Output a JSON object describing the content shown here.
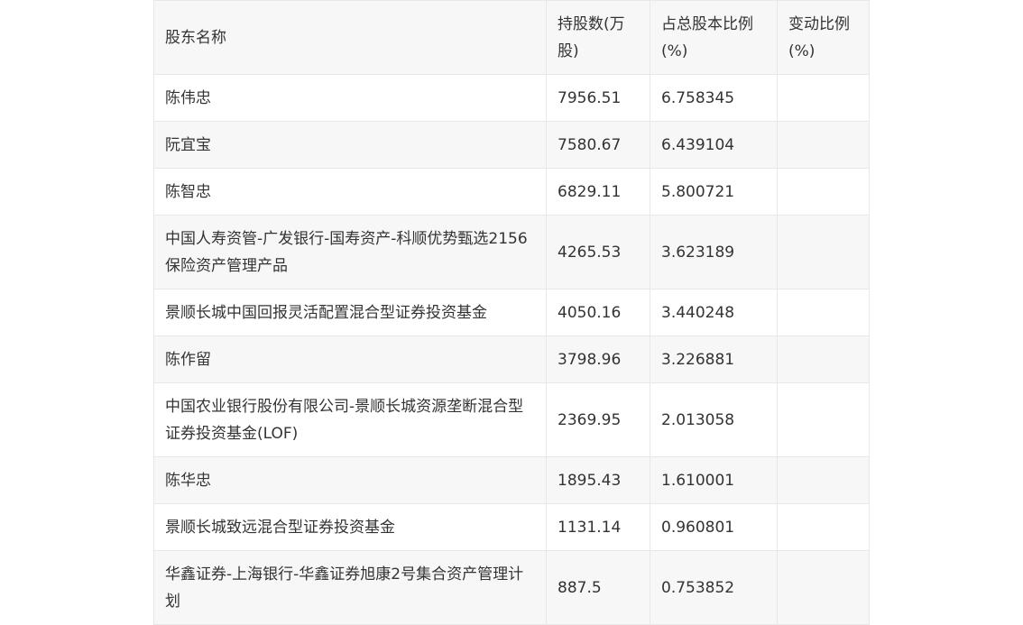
{
  "table": {
    "headers": [
      "股东名称",
      "持股数(万股)",
      "占总股本比例(%)",
      "变动比例(%)"
    ],
    "rows": [
      {
        "name": "陈伟忠",
        "shares": "7956.51",
        "ratio": "6.758345",
        "change": ""
      },
      {
        "name": "阮宜宝",
        "shares": "7580.67",
        "ratio": "6.439104",
        "change": ""
      },
      {
        "name": "陈智忠",
        "shares": "6829.11",
        "ratio": "5.800721",
        "change": ""
      },
      {
        "name": "中国人寿资管-广发银行-国寿资产-科顺优势甄选2156保险资产管理产品",
        "shares": "4265.53",
        "ratio": "3.623189",
        "change": ""
      },
      {
        "name": "景顺长城中国回报灵活配置混合型证券投资基金",
        "shares": "4050.16",
        "ratio": "3.440248",
        "change": ""
      },
      {
        "name": "陈作留",
        "shares": "3798.96",
        "ratio": "3.226881",
        "change": ""
      },
      {
        "name": "中国农业银行股份有限公司-景顺长城资源垄断混合型证券投资基金(LOF)",
        "shares": "2369.95",
        "ratio": "2.013058",
        "change": ""
      },
      {
        "name": "陈华忠",
        "shares": "1895.43",
        "ratio": "1.610001",
        "change": ""
      },
      {
        "name": "景顺长城致远混合型证券投资基金",
        "shares": "1131.14",
        "ratio": "0.960801",
        "change": ""
      },
      {
        "name": "华鑫证券-上海银行-华鑫证券旭康2号集合资产管理计划",
        "shares": "887.5",
        "ratio": "0.753852",
        "change": ""
      }
    ]
  }
}
